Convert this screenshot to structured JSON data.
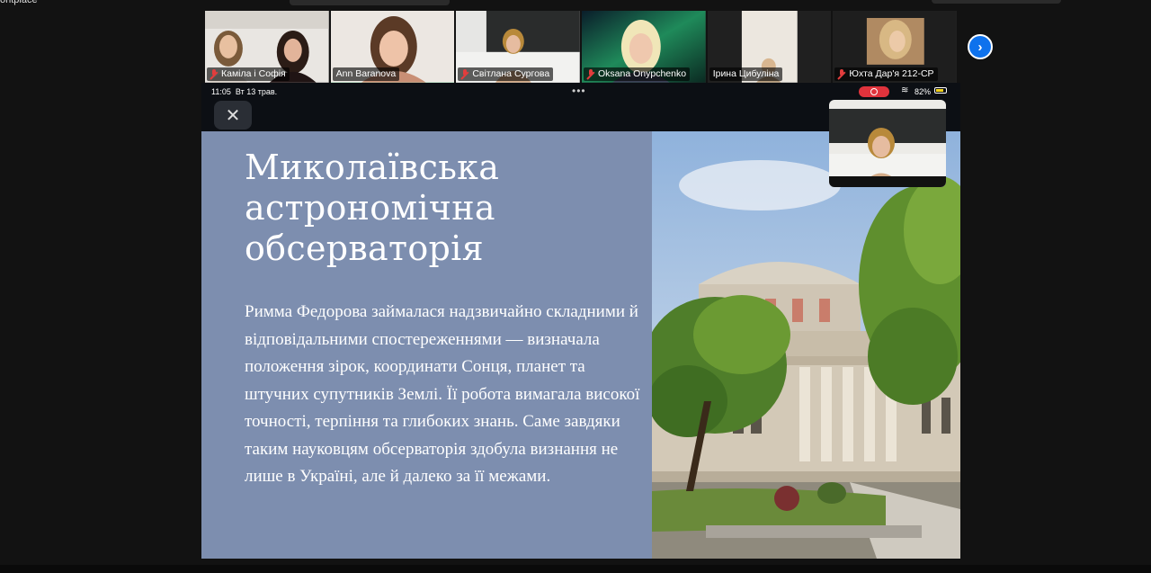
{
  "window": {
    "cut_label": "ontplace"
  },
  "participants": [
    {
      "name": "Каміла і Софія",
      "muted": true
    },
    {
      "name": "Ann Baranova",
      "muted": false,
      "active": true
    },
    {
      "name": "Світлана Сургова",
      "muted": true
    },
    {
      "name": "Oksana Onypchenko",
      "muted": true
    },
    {
      "name": "Ірина Цибуліна",
      "muted": false
    },
    {
      "name": "Юхта Дар'я 212-СР",
      "muted": true
    }
  ],
  "strip_next_icon": "chevron-right-icon",
  "ipad_status": {
    "time": "11:05",
    "date": "Вт 13 трав.",
    "menu_dots": "•••",
    "battery": "82%"
  },
  "close_icon": "✕",
  "slide": {
    "title": "Миколаївська астрономічна обсерваторія",
    "body": "Римма Федорова займалася надзвичайно складними й відповідальними спостереженнями — визначала положення зірок, координати Сонця, планет та штучних супутників Землі. Її робота вимагала високої точності, терпіння та глибоких знань. Саме завдяки таким науковцям обсерваторія здобула визнання не лише в Україні, але й далеко за її межами.",
    "background_color": "#7d8eaf"
  }
}
